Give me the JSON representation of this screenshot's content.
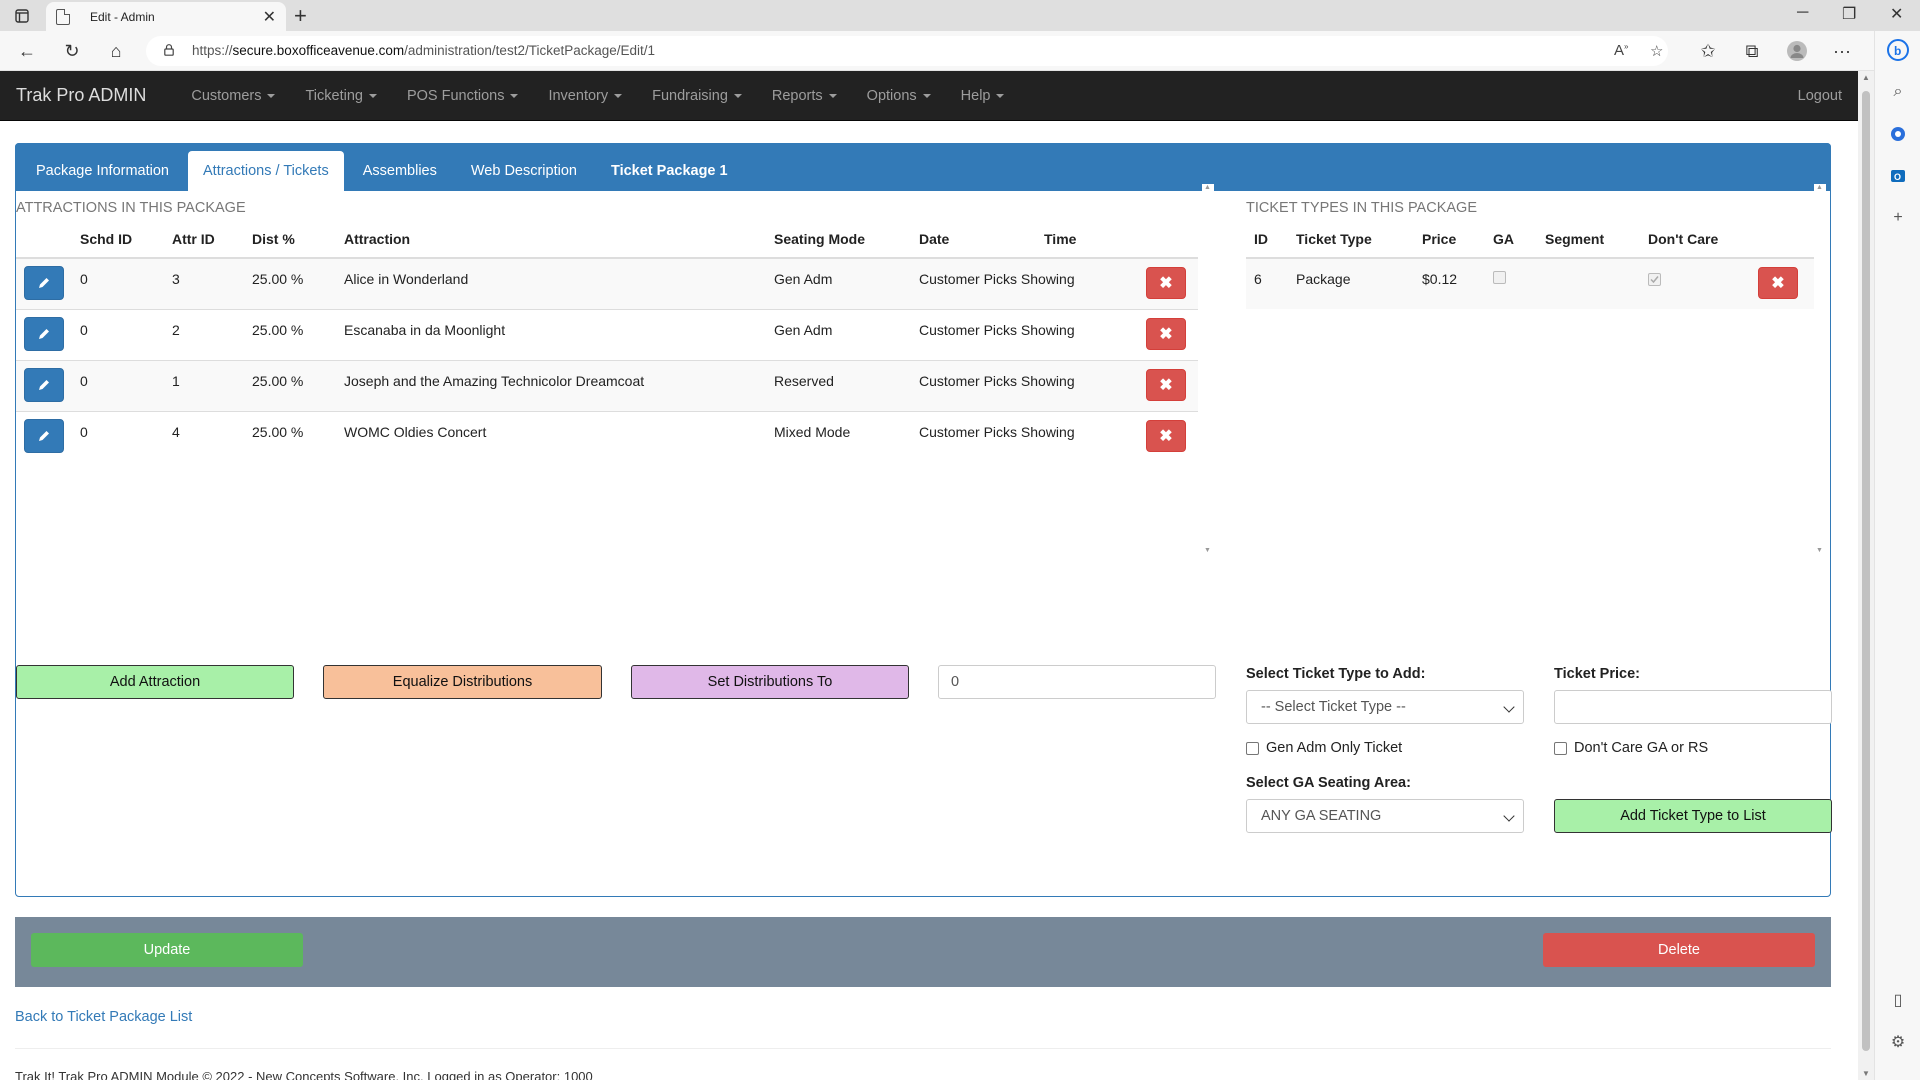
{
  "browser": {
    "tab_title": "Edit - Admin",
    "url_prefix": "https://",
    "url_host": "secure.boxofficeavenue.com",
    "url_path": "/administration/test2/TicketPackage/Edit/1"
  },
  "navbar": {
    "brand": "Trak Pro ADMIN",
    "items": [
      "Customers",
      "Ticketing",
      "POS Functions",
      "Inventory",
      "Fundraising",
      "Reports",
      "Options",
      "Help"
    ],
    "logout": "Logout"
  },
  "tabs": [
    "Package Information",
    "Attractions / Tickets",
    "Assemblies",
    "Web Description",
    "Ticket Package 1"
  ],
  "attractions": {
    "title": "ATTRACTIONS IN THIS PACKAGE",
    "headers": {
      "schd": "Schd ID",
      "attr": "Attr ID",
      "dist": "Dist %",
      "attraction": "Attraction",
      "mode": "Seating Mode",
      "date": "Date",
      "time": "Time"
    },
    "rows": [
      {
        "schd": "0",
        "attr": "3",
        "dist": "25.00 %",
        "name": "Alice in Wonderland",
        "mode": "Gen Adm",
        "date": "Customer Picks Showing"
      },
      {
        "schd": "0",
        "attr": "2",
        "dist": "25.00 %",
        "name": "Escanaba in da Moonlight",
        "mode": "Gen Adm",
        "date": "Customer Picks Showing"
      },
      {
        "schd": "0",
        "attr": "1",
        "dist": "25.00 %",
        "name": "Joseph and the Amazing Technicolor Dreamcoat",
        "mode": "Reserved",
        "date": "Customer Picks Showing"
      },
      {
        "schd": "0",
        "attr": "4",
        "dist": "25.00 %",
        "name": "WOMC Oldies Concert",
        "mode": "Mixed Mode",
        "date": "Customer Picks Showing"
      }
    ],
    "add_btn": "Add Attraction",
    "equalize_btn": "Equalize Distributions",
    "setdist_btn": "Set Distributions To",
    "setdist_value": "0"
  },
  "tickets": {
    "title": "TICKET TYPES IN THIS PACKAGE",
    "headers": {
      "id": "ID",
      "type": "Ticket Type",
      "price": "Price",
      "ga": "GA",
      "segment": "Segment",
      "dontcare": "Don't Care"
    },
    "rows": [
      {
        "id": "6",
        "type": "Package",
        "price": "$0.12",
        "segment": ""
      }
    ],
    "select_label": "Select Ticket Type to Add:",
    "select_value": "-- Select Ticket Type --",
    "price_label": "Ticket Price:",
    "price_value": "",
    "genadm_label": "Gen Adm Only Ticket",
    "dontcare_label": "Don't Care GA or RS",
    "ga_area_label": "Select GA Seating Area:",
    "ga_area_value": "ANY GA SEATING",
    "add_btn": "Add Ticket Type to List"
  },
  "footer": {
    "update": "Update",
    "delete": "Delete",
    "back_link": "Back to Ticket Package List",
    "copyright": "Trak It! Trak Pro ADMIN Module © 2022 - New Concepts Software, Inc.      Logged in as Operator: 1000"
  },
  "colors": {
    "primary": "#337ab7",
    "danger": "#d9534f",
    "success": "#5cb85c",
    "add_attraction": "#a8f0a8",
    "equalize": "#f8c09a",
    "setdist": "#e0b8e8",
    "navbar": "#222222",
    "footer_bar": "#778899"
  }
}
